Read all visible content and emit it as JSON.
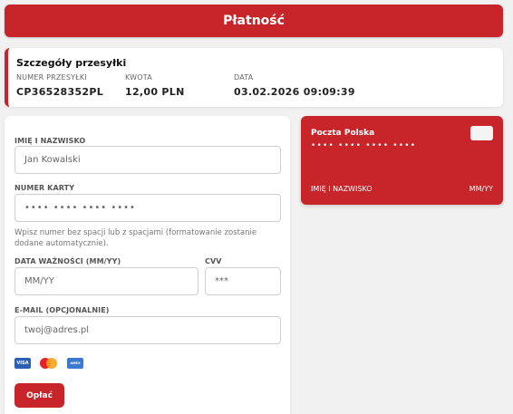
{
  "header": {
    "title": "Płatność"
  },
  "details": {
    "title": "Szczegóły przesyłki",
    "columns": [
      {
        "label": "NUMER PRZESYŁKI",
        "value": "CP36528352PL"
      },
      {
        "label": "KWOTA",
        "value": "12,00 PLN"
      },
      {
        "label": "DATA",
        "value": "03.02.2026 09:09:39"
      }
    ]
  },
  "form": {
    "name": {
      "label": "IMIĘ I NAZWISKO",
      "placeholder": "Jan Kowalski"
    },
    "card_number": {
      "label": "NUMER KARTY",
      "placeholder": "•••• •••• •••• ••••",
      "hint": "Wpisz numer bez spacji lub z spacjami (formatowanie zostanie dodane automatycznie)."
    },
    "expiry": {
      "label": "DATA WAŻNOŚCI (MM/YY)",
      "placeholder": "MM/YY"
    },
    "cvv": {
      "label": "CVV",
      "placeholder": "***"
    },
    "email": {
      "label": "E-MAIL (OPCJONALNIE)",
      "placeholder": "twoj@adres.pl"
    },
    "brands": {
      "visa": "VISA",
      "amex": "AMEX"
    },
    "submit_label": "Opłać"
  },
  "card_preview": {
    "brand": "Poczta Polska",
    "number": "•••• •••• •••• ••••",
    "holder": "IMIĘ I NAZWISKO",
    "expiry": "MM/YY"
  },
  "colors": {
    "accent": "#c8252b",
    "background": "#f1f1f1"
  }
}
